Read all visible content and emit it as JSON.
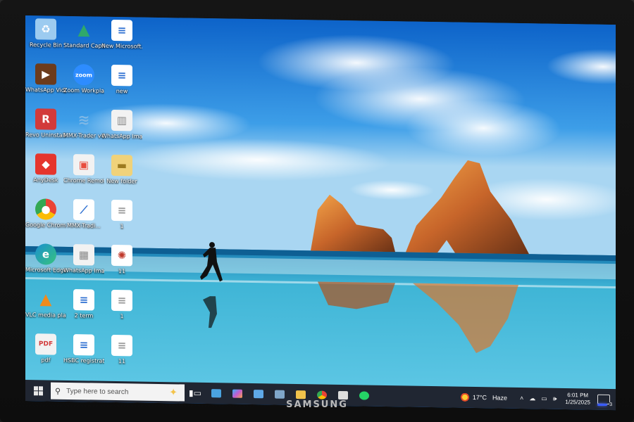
{
  "monitor": {
    "brand": "SAMSUNG"
  },
  "desktop": {
    "icons": [
      {
        "label": "Recycle Bin",
        "icon": "recycle-bin-icon",
        "color": "#9ccbf0"
      },
      {
        "label": "WhatsApp Video 2025...",
        "icon": "video-file-icon",
        "color": "#6c3b1c"
      },
      {
        "label": "Revo Uninstaller",
        "icon": "revo-uninstaller-icon",
        "color": "#d23a3a"
      },
      {
        "label": "AnyDesk",
        "icon": "anydesk-icon",
        "color": "#e5352d"
      },
      {
        "label": "Google Chrome",
        "icon": "chrome-icon",
        "color": "#2e9e4f"
      },
      {
        "label": "Microsoft Edge",
        "icon": "edge-icon",
        "color": "#1b8fd1"
      },
      {
        "label": "VLC media player",
        "icon": "vlc-icon",
        "color": "#f08b1d"
      },
      {
        "label": "pdf",
        "icon": "pdf-file-icon",
        "color": "#f2f2f2"
      },
      {
        "label": "Standard Capital Sec...",
        "icon": "trading-app-icon",
        "color": "#2fa86b"
      },
      {
        "label": "Zoom Workplace",
        "icon": "zoom-icon",
        "color": "#2d8cff"
      },
      {
        "label": "MMX-Trader v4.41",
        "icon": "mmx-trader-icon",
        "color": "#7fb8e6"
      },
      {
        "label": "Chrome Remote...",
        "icon": "chrome-remote-icon",
        "color": "#e84c3d"
      },
      {
        "label": "MMX-Tradi...",
        "icon": "mmx-trader-shortcut-icon",
        "color": "#ffffff"
      },
      {
        "label": "WhatsApp Image 2025...",
        "icon": "image-file-icon",
        "color": "#f2f2f2"
      },
      {
        "label": "2 term",
        "icon": "document-icon",
        "color": "#ffffff"
      },
      {
        "label": "HSBC registrati...",
        "icon": "document-icon",
        "color": "#ffffff"
      },
      {
        "label": "New Microsoft...",
        "icon": "document-icon",
        "color": "#ffffff"
      },
      {
        "label": "new",
        "icon": "document-icon",
        "color": "#ffffff"
      },
      {
        "label": "WhatsApp Image 2025...",
        "icon": "image-file-icon",
        "color": "#f2f2f2"
      },
      {
        "label": "New folder",
        "icon": "folder-icon",
        "color": "#f0d27a"
      },
      {
        "label": "1",
        "icon": "document-icon",
        "color": "#ffffff"
      },
      {
        "label": "11",
        "icon": "image-file-icon",
        "color": "#ffffff"
      },
      {
        "label": "1",
        "icon": "document-icon",
        "color": "#ffffff"
      },
      {
        "label": "11",
        "icon": "document-icon",
        "color": "#ffffff"
      }
    ]
  },
  "taskbar": {
    "search_placeholder": "Type here to search",
    "apps": [
      {
        "name": "task-view",
        "icon": "task-view-icon",
        "color": "#ffffff"
      },
      {
        "name": "taskbar-app-1",
        "icon": "window-app-icon",
        "color": "#4aa3e0"
      },
      {
        "name": "copilot",
        "icon": "copilot-icon",
        "color": "#c35bd1"
      },
      {
        "name": "taskbar-app-3",
        "icon": "calculator-icon",
        "color": "#5fa9e8"
      },
      {
        "name": "taskbar-app-4",
        "icon": "remote-app-icon",
        "color": "#7fa6c9"
      },
      {
        "name": "file-explorer",
        "icon": "folder-icon",
        "color": "#f0c24b"
      },
      {
        "name": "chrome",
        "icon": "chrome-icon",
        "color": "#34a853"
      },
      {
        "name": "taskbar-app-7",
        "icon": "app-icon",
        "color": "#dddddd"
      },
      {
        "name": "whatsapp",
        "icon": "whatsapp-icon",
        "color": "#25d366"
      }
    ],
    "weather": {
      "temp": "17°C",
      "condition": "Haze"
    },
    "clock": {
      "time": "6:01 PM",
      "date": "1/25/2025"
    },
    "notifications": "3"
  }
}
